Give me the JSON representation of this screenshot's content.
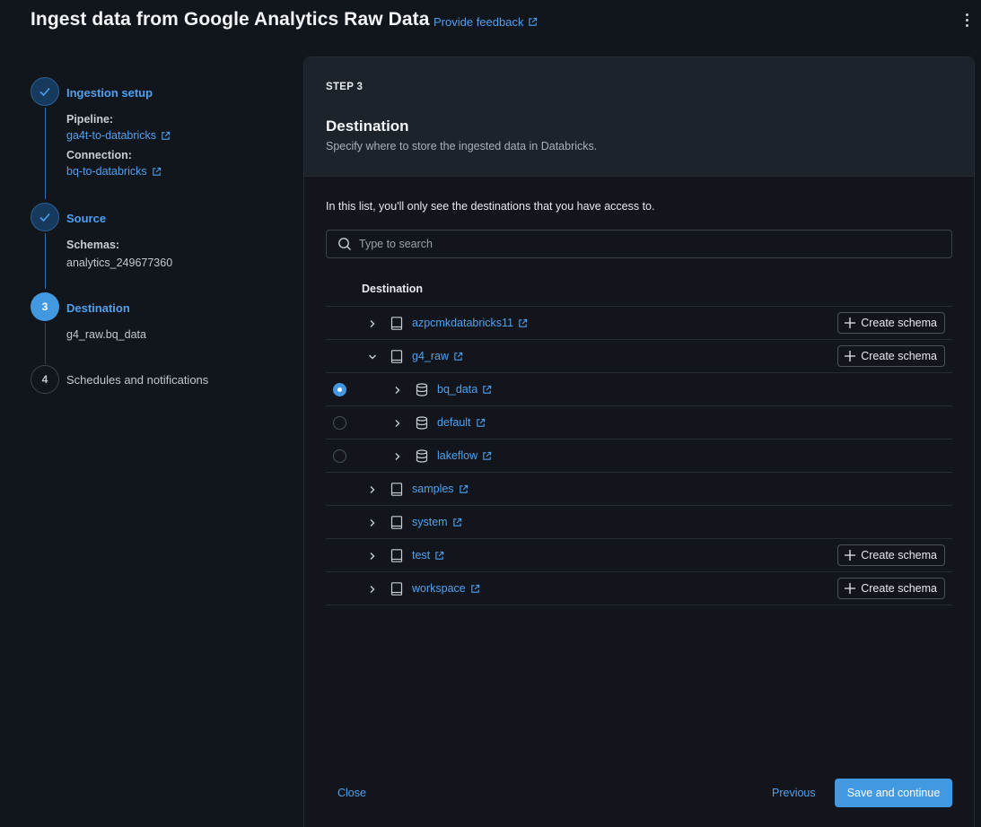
{
  "header": {
    "title": "Ingest data from Google Analytics Raw Data",
    "feedback_label": "Provide feedback"
  },
  "stepper": {
    "steps": [
      {
        "number": "1",
        "title": "Ingestion setup",
        "state": "done",
        "pipeline_label": "Pipeline:",
        "pipeline_value": "ga4t-to-databricks",
        "connection_label": "Connection:",
        "connection_value": "bq-to-databricks"
      },
      {
        "number": "2",
        "title": "Source",
        "state": "done",
        "schemas_label": "Schemas:",
        "schemas_value": "analytics_249677360"
      },
      {
        "number": "3",
        "title": "Destination",
        "state": "active",
        "value": "g4_raw.bq_data"
      },
      {
        "number": "4",
        "title": "Schedules and notifications",
        "state": "todo"
      }
    ]
  },
  "panel": {
    "step_label": "STEP 3",
    "title": "Destination",
    "subtitle": "Specify where to store the ingested data in Databricks.",
    "access_note": "In this list, you'll only see the destinations that you have access to.",
    "search_placeholder": "Type to search",
    "column_header": "Destination",
    "create_schema_label": "Create schema",
    "rows": [
      {
        "name": "azpcmkdatabricks11",
        "level": 0,
        "type": "catalog",
        "expanded": false,
        "radio": null,
        "create_schema": true
      },
      {
        "name": "g4_raw",
        "level": 0,
        "type": "catalog",
        "expanded": true,
        "radio": null,
        "create_schema": true
      },
      {
        "name": "bq_data",
        "level": 1,
        "type": "schema",
        "expanded": false,
        "radio": "checked",
        "create_schema": false
      },
      {
        "name": "default",
        "level": 1,
        "type": "schema",
        "expanded": false,
        "radio": "unchecked",
        "create_schema": false
      },
      {
        "name": "lakeflow",
        "level": 1,
        "type": "schema",
        "expanded": false,
        "radio": "unchecked",
        "create_schema": false
      },
      {
        "name": "samples",
        "level": 0,
        "type": "catalog",
        "expanded": false,
        "radio": null,
        "create_schema": false
      },
      {
        "name": "system",
        "level": 0,
        "type": "catalog",
        "expanded": false,
        "radio": null,
        "create_schema": false
      },
      {
        "name": "test",
        "level": 0,
        "type": "catalog",
        "expanded": false,
        "radio": null,
        "create_schema": true
      },
      {
        "name": "workspace",
        "level": 0,
        "type": "catalog",
        "expanded": false,
        "radio": null,
        "create_schema": true
      }
    ]
  },
  "footer": {
    "close_label": "Close",
    "previous_label": "Previous",
    "save_label": "Save and continue"
  },
  "colors": {
    "background": "#11151c",
    "accent": "#4299e1",
    "link": "#4ea1f0"
  }
}
